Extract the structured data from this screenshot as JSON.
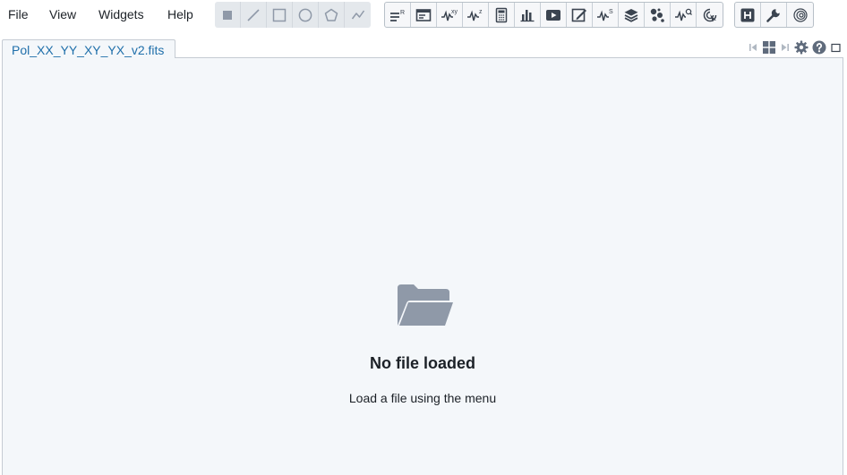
{
  "menu": {
    "file": "File",
    "view": "View",
    "widgets": "Widgets",
    "help": "Help"
  },
  "toolbars": {
    "region_tools": [
      "point-region-icon",
      "line-region-icon",
      "rectangle-region-icon",
      "ellipse-region-icon",
      "polygon-region-icon",
      "polyline-region-icon"
    ],
    "widget_tools": [
      "region-list-icon",
      "image-info-icon",
      "spatial-profiler-icon",
      "spectral-profiler-icon",
      "statistics-icon",
      "histogram-icon",
      "animator-icon",
      "render-config-icon",
      "stokes-analysis-icon",
      "image-fitting-icon",
      "catalog-icon",
      "line-query-icon",
      "moment-generator-icon"
    ],
    "widget_superscripts": {
      "region_list": "R",
      "spatial_profiler": "xy",
      "spectral_profiler": "z",
      "stokes_analysis": "S"
    },
    "utility_tools": [
      "fits-header-icon",
      "preferences-icon",
      "contours-icon"
    ]
  },
  "tab": {
    "label": "Pol_XX_YY_XY_YX_v2.fits"
  },
  "tab_controls": [
    "first-frame-icon",
    "layout-grid-icon",
    "next-frame-icon",
    "settings-gear-icon",
    "help-icon",
    "maximize-icon"
  ],
  "empty_state": {
    "icon": "folder-open-icon",
    "title": "No file loaded",
    "description": "Load a file using the menu"
  },
  "colors": {
    "icon": "#5f6b7c",
    "tab_text": "#1f6faa",
    "panel_bg": "#f4f7fa",
    "folder": "#8f99a8"
  }
}
